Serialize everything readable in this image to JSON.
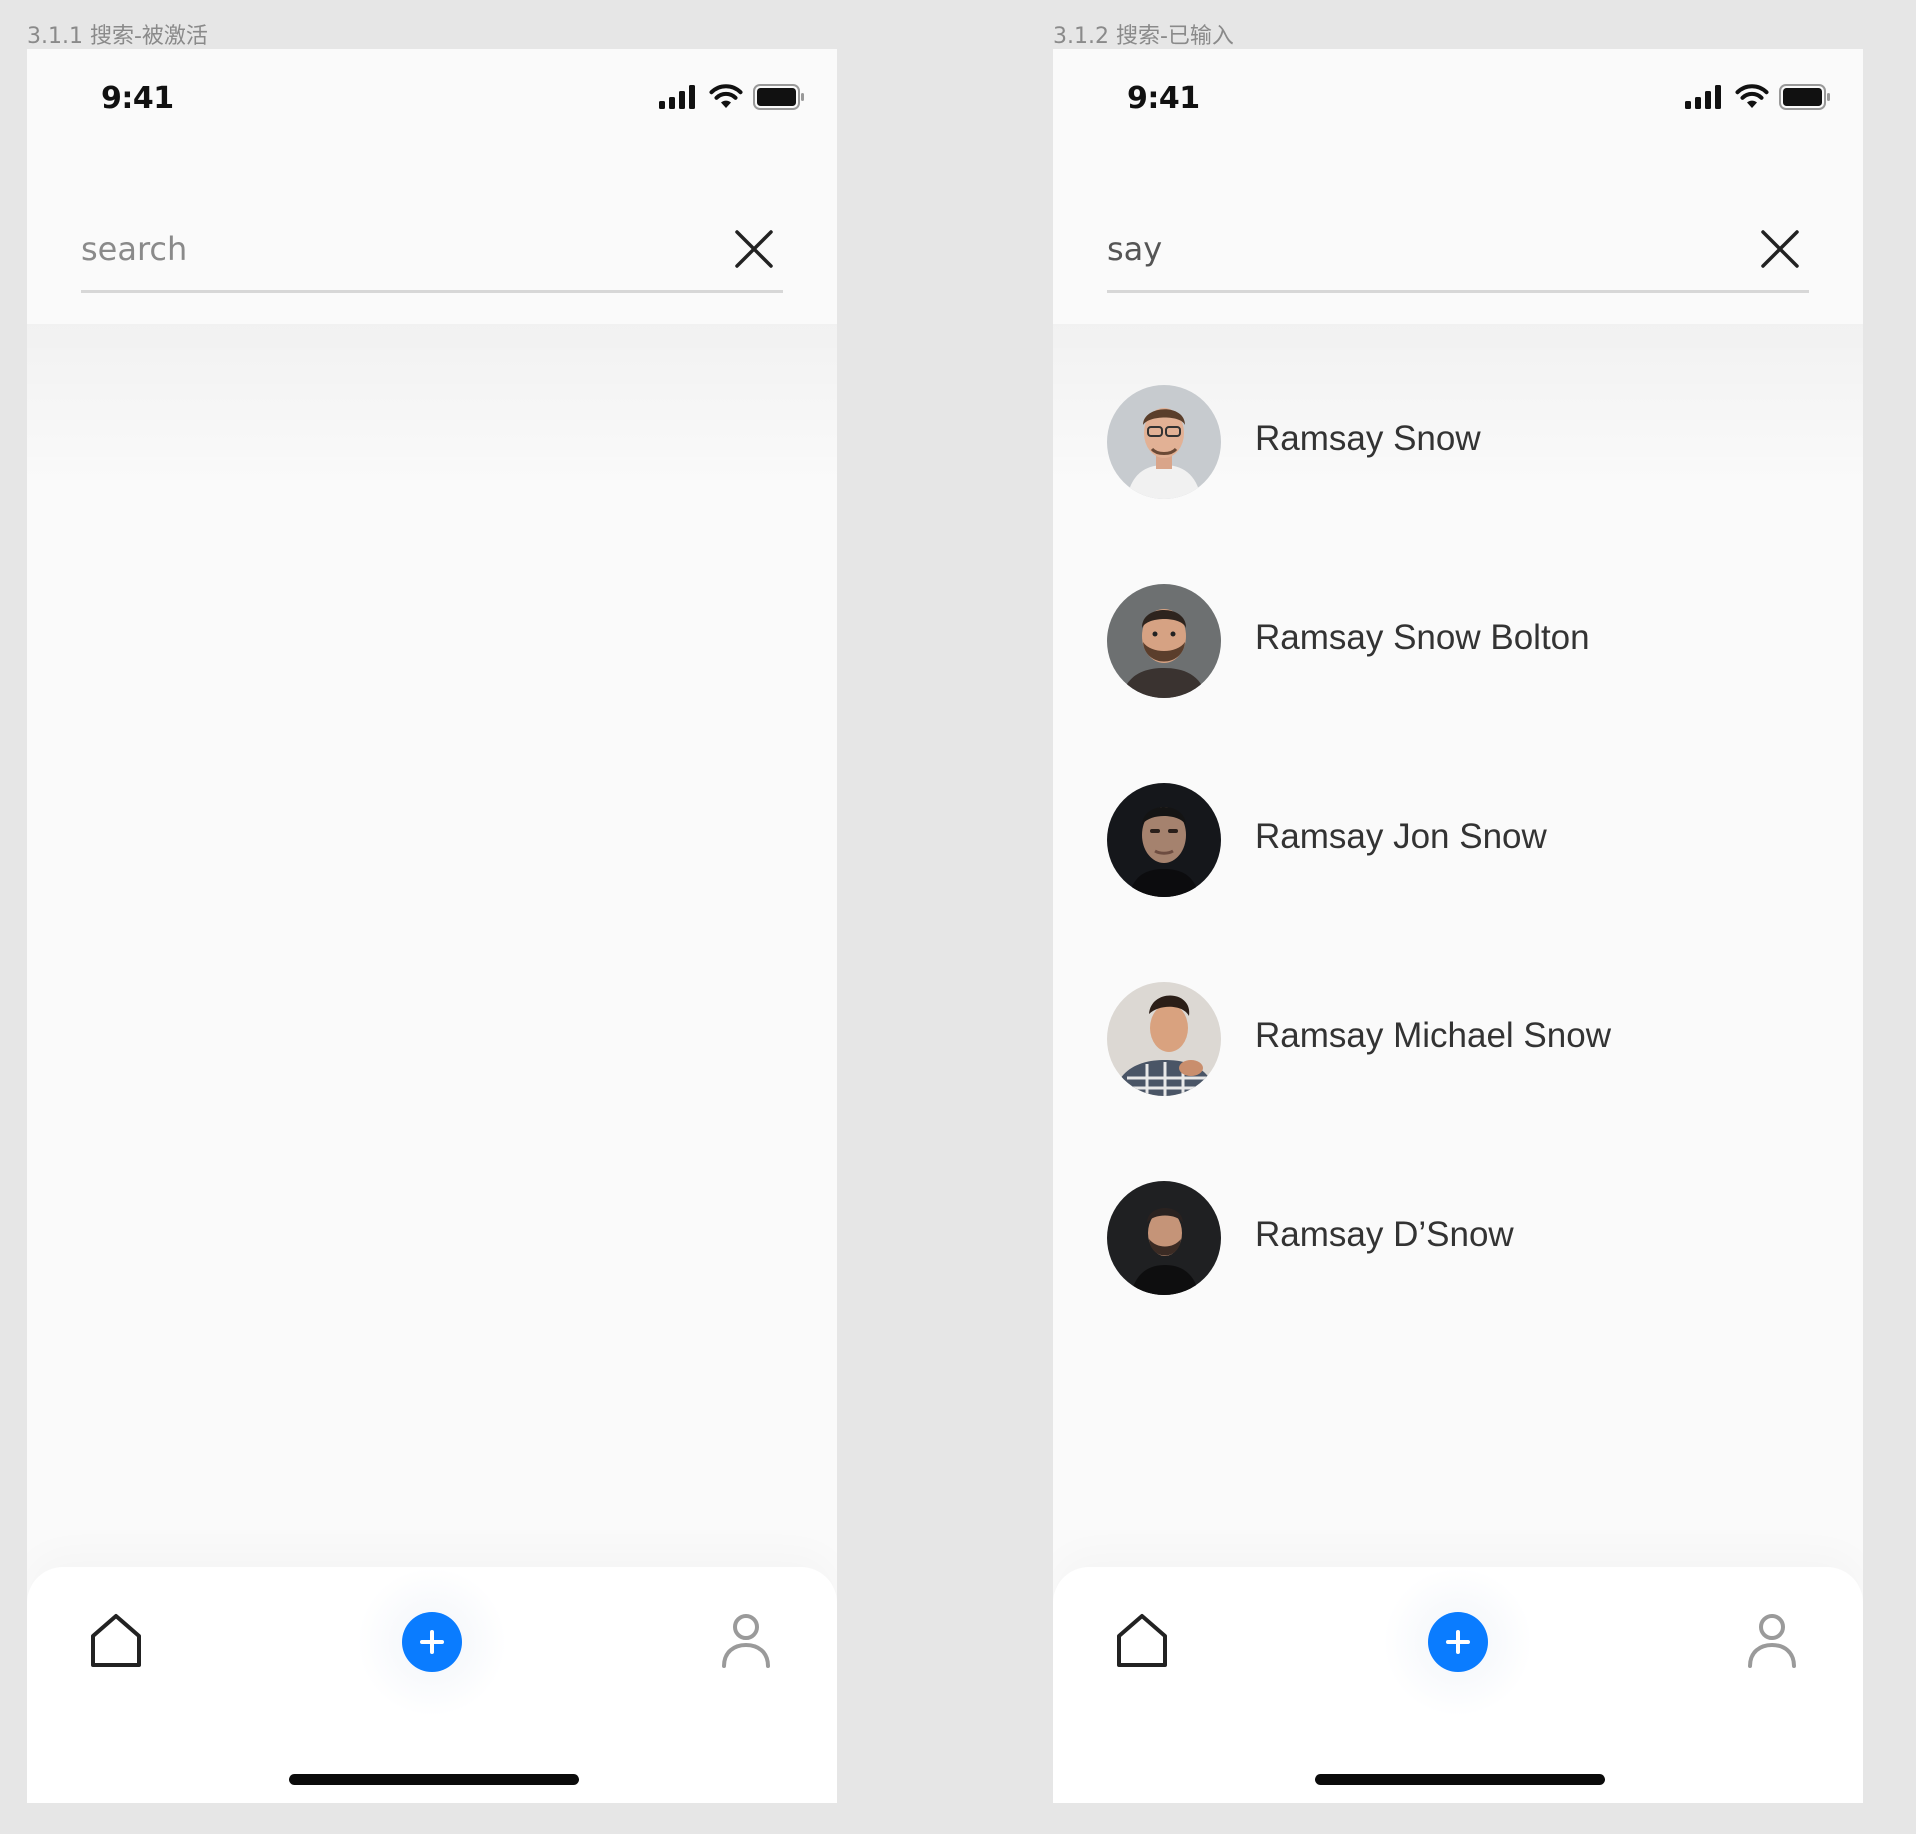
{
  "frames": [
    {
      "caption": "3.1.1 搜索-被激活",
      "status_bar": {
        "time": "9:41",
        "signal_icon": "cellular-signal-icon",
        "wifi_icon": "wifi-icon",
        "battery_icon": "battery-icon"
      },
      "search": {
        "value": "",
        "placeholder": "search",
        "clear_icon": "close-icon"
      },
      "results": [],
      "tab_bar": {
        "home_icon": "home-icon",
        "add_icon": "plus-icon",
        "profile_icon": "person-icon"
      },
      "colors": {
        "accent": "#0a7cff"
      }
    },
    {
      "caption": "3.1.2 搜索-已输入",
      "status_bar": {
        "time": "9:41",
        "signal_icon": "cellular-signal-icon",
        "wifi_icon": "wifi-icon",
        "battery_icon": "battery-icon"
      },
      "search": {
        "value": "say",
        "placeholder": "search",
        "clear_icon": "close-icon"
      },
      "results": [
        {
          "name": "Ramsay Snow",
          "avatar_bg": "#c8cccf"
        },
        {
          "name": "Ramsay Snow Bolton",
          "avatar_bg": "#6c6f70"
        },
        {
          "name": "Ramsay Jon Snow",
          "avatar_bg": "#1b1d22"
        },
        {
          "name": "Ramsay Michael Snow",
          "avatar_bg": "#d9d5d0"
        },
        {
          "name": "Ramsay D’Snow",
          "avatar_bg": "#222325"
        }
      ],
      "tab_bar": {
        "home_icon": "home-icon",
        "add_icon": "plus-icon",
        "profile_icon": "person-icon"
      },
      "colors": {
        "accent": "#0a7cff"
      }
    }
  ]
}
